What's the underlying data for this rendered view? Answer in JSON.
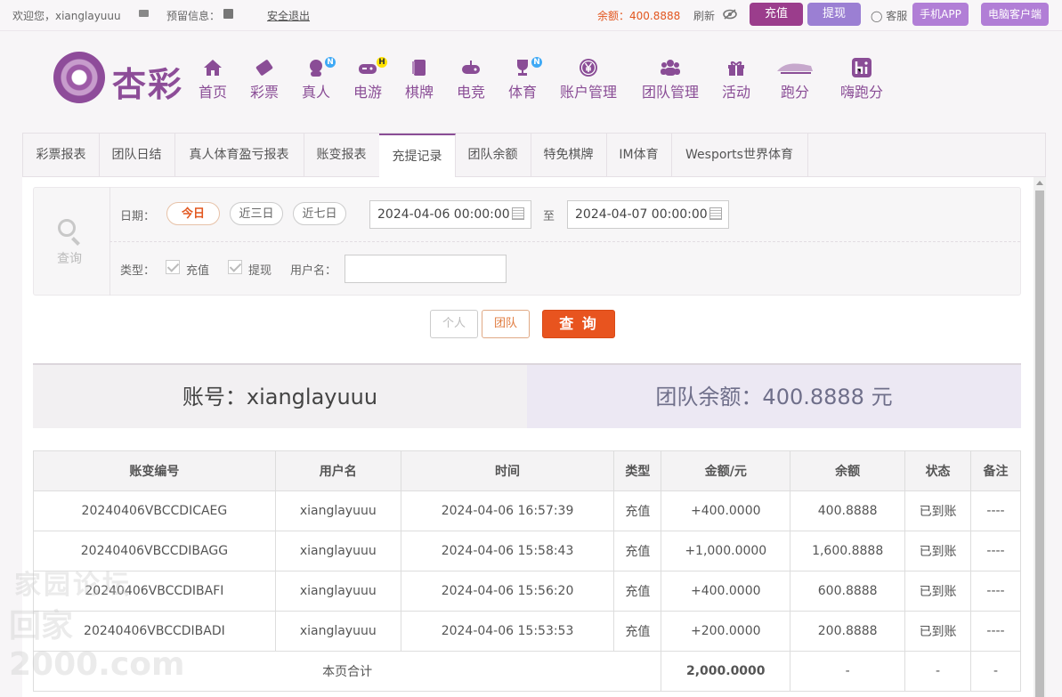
{
  "topbar": {
    "welcome": "欢迎您，xianglayuuu",
    "reserved_label": "预留信息：",
    "logout": "安全退出",
    "balance": "余额：400.8888",
    "refresh": "刷新",
    "recharge": "充值",
    "withdraw": "提现",
    "service": "客服",
    "mobile_app": "手机APP",
    "pc_client": "电脑客户端"
  },
  "brand": {
    "name": "杏彩"
  },
  "nav": [
    {
      "label": "首页",
      "icon": "home-icon"
    },
    {
      "label": "彩票",
      "icon": "lottery-ticket-icon"
    },
    {
      "label": "真人",
      "icon": "live-dealer-icon",
      "badge": "N"
    },
    {
      "label": "电游",
      "icon": "gamepad-icon",
      "badge": "H"
    },
    {
      "label": "棋牌",
      "icon": "cards-icon"
    },
    {
      "label": "电竞",
      "icon": "esports-controller-icon"
    },
    {
      "label": "体育",
      "icon": "trophy-icon",
      "badge": "N"
    },
    {
      "label": "账户管理",
      "icon": "yen-coin-icon"
    },
    {
      "label": "团队管理",
      "icon": "team-icon"
    },
    {
      "label": "活动",
      "icon": "gift-icon"
    },
    {
      "label": "跑分",
      "icon": "running-icon"
    },
    {
      "label": "嗨跑分",
      "icon": "hi-icon"
    }
  ],
  "tabs": [
    "彩票报表",
    "团队日结",
    "真人体育盈亏报表",
    "账变报表",
    "充提记录",
    "团队余额",
    "特免棋牌",
    "IM体育",
    "Wesports世界体育"
  ],
  "active_tab": "充提记录",
  "filter": {
    "query_label": "查询",
    "date_label": "日期：",
    "quick_ranges": [
      "今日",
      "近三日",
      "近七日"
    ],
    "selected_range": "今日",
    "start": "2024-04-06 00:00:00",
    "to": "至",
    "end": "2024-04-07 00:00:00",
    "type_label": "类型：",
    "types": [
      "充值",
      "提现"
    ],
    "username_label": "用户名：",
    "username_value": ""
  },
  "actions": {
    "personal": "个人",
    "team": "团队",
    "query": "查 询"
  },
  "summary": {
    "account": "账号：xianglayuuu",
    "team_balance": "团队余额：400.8888 元"
  },
  "table": {
    "headers": [
      "账变编号",
      "用户名",
      "时间",
      "类型",
      "金额/元",
      "余额",
      "状态",
      "备注"
    ],
    "rows": [
      [
        "20240406VBCCDICAEG",
        "xianglayuuu",
        "2024-04-06 16:57:39",
        "充值",
        "+400.0000",
        "400.8888",
        "已到账",
        "----"
      ],
      [
        "20240406VBCCDIBAGG",
        "xianglayuuu",
        "2024-04-06 15:58:43",
        "充值",
        "+1,000.0000",
        "1,600.8888",
        "已到账",
        "----"
      ],
      [
        "20240406VBCCDIBAFI",
        "xianglayuuu",
        "2024-04-06 15:56:20",
        "充值",
        "+400.0000",
        "600.8888",
        "已到账",
        "----"
      ],
      [
        "20240406VBCCDIBADI",
        "xianglayuuu",
        "2024-04-06 15:53:53",
        "充值",
        "+200.0000",
        "200.8888",
        "已到账",
        "----"
      ]
    ],
    "total": {
      "label": "本页合计",
      "amount": "2,000.0000",
      "balance": "-",
      "status": "-",
      "note": "-"
    }
  },
  "watermark": {
    "line1": "家园论坛",
    "line2": "回家2000.com"
  },
  "colors": {
    "accent": "#8a4d96",
    "orange": "#e8541f",
    "green": "#3a9a17"
  }
}
